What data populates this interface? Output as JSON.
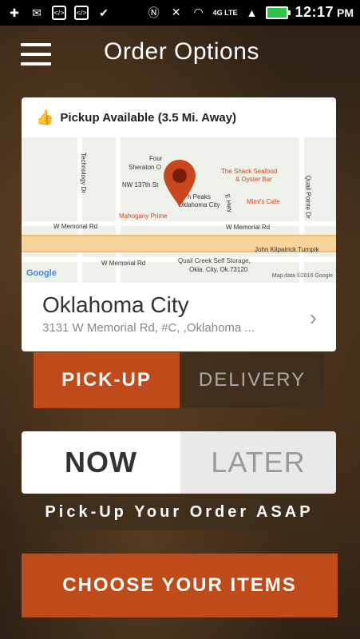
{
  "status_bar": {
    "time": "12:17",
    "ampm": "PM",
    "network": "4G LTE",
    "left_icons": [
      "plus-icon",
      "mail-icon",
      "code-icon",
      "code-icon",
      "check-icon"
    ],
    "right_icons": [
      "nfc-icon",
      "mute-icon",
      "wifi-icon",
      "signal-icon",
      "battery-icon"
    ]
  },
  "header": {
    "title": "Order Options"
  },
  "location_card": {
    "availability": "Pickup Available (3.5 Mi. Away)",
    "city": "Oklahoma City",
    "address": "3131 W Memorial Rd, #C, ,Oklahoma ...",
    "map": {
      "labels": {
        "technology": "Technology Dr",
        "four_points": "Four",
        "sheraton": "Sheraton O",
        "nw137": "NW 137th St",
        "shack": "The Shack Seafood",
        "oyster": "& Oyster Bar",
        "peaks": "h Peaks",
        "okcity": "Oklahoma City",
        "mimis": "Mimi's Cafe",
        "mahogany": "Mahogany Prime",
        "quail": "Quail Pointe Dr",
        "eamy": "E Hwy",
        "memorial1": "W Memorial Rd",
        "memorial2": "W Memorial Rd",
        "memorial3": "W Memorial Rd",
        "memorial4": "W Memorial Rd",
        "turnpike": "John Kilpatrick Turnpik",
        "quailcreek": "Quail Creek Self Storage,",
        "quailcreek2": "Okla. City, Ok.73120",
        "google": "Google",
        "mapdata": "Map data ©2016 Google"
      }
    }
  },
  "mode": {
    "pickup_label": "PICK-UP",
    "delivery_label": "DELIVERY",
    "selected": "pickup"
  },
  "timing": {
    "now_label": "NOW",
    "later_label": "LATER",
    "selected": "now",
    "message": "Pick-Up Your Order ASAP"
  },
  "cta": {
    "label": "CHOOSE YOUR ITEMS"
  },
  "colors": {
    "accent": "#bf4a1a",
    "battery": "#2ec24a"
  }
}
